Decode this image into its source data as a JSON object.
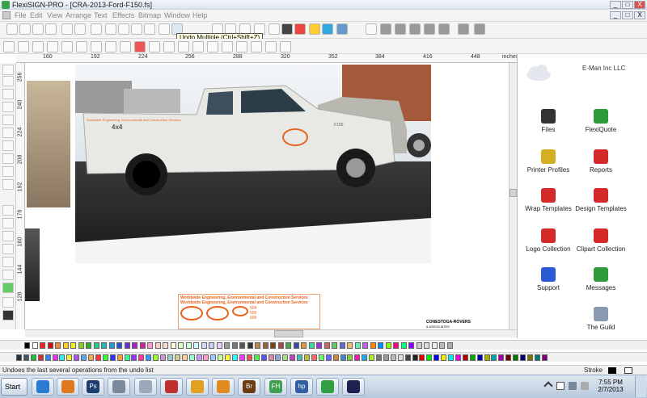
{
  "window": {
    "title": "FlexiSIGN-PRO - [CRA-2013-Ford-F150.fs]",
    "controls": [
      "_",
      "□",
      "X"
    ],
    "doc_controls": [
      "_",
      "□",
      "X"
    ]
  },
  "menu": [
    "File",
    "Edit",
    "View",
    "Arrange",
    "Text",
    "Effects",
    "Bitmap",
    "Window",
    "Help"
  ],
  "tooltip": "Undo Multiple (Ctrl+Shift+Z)",
  "ruler": {
    "unit": "inches",
    "h_labels": [
      "160",
      "192",
      "224",
      "256",
      "288",
      "320",
      "352",
      "384",
      "416",
      "448"
    ],
    "v_labels": [
      "256",
      "240",
      "224",
      "208",
      "192",
      "176",
      "160",
      "144",
      "128"
    ]
  },
  "canvas": {
    "truck_badge": "4x4",
    "truck_slogan": "Worldwide Engineering, Environmental and Construction Services",
    "truck_model": "F150",
    "decal_line1": "Worldwide Engineering, Environmental and Construction Services",
    "decal_line2": "Worldwide Engineering, Environmental and Construction Services",
    "decal_numbers": [
      "504",
      "505",
      "506"
    ],
    "company_logo_line1": "CONESTOGA-ROVERS",
    "company_logo_line2": "& ASSOCIATES"
  },
  "panel": {
    "company": "E-Man Inc LLC",
    "items": [
      {
        "label": "Files",
        "icon": "files-icon",
        "color": "#333333"
      },
      {
        "label": "FlexiQuote",
        "icon": "flexiquote-icon",
        "color": "#2e9b3a"
      },
      {
        "label": "Printer Profiles",
        "icon": "printer-profiles-icon",
        "color": "#d4b020"
      },
      {
        "label": "Reports",
        "icon": "reports-icon",
        "color": "#d42a2a"
      },
      {
        "label": "Wrap Templates",
        "icon": "wrap-templates-icon",
        "color": "#d42a2a"
      },
      {
        "label": "Design Templates",
        "icon": "design-templates-icon",
        "color": "#d42a2a"
      },
      {
        "label": "Logo Collection",
        "icon": "logo-collection-icon",
        "color": "#d42a2a"
      },
      {
        "label": "Clipart Collection",
        "icon": "clipart-collection-icon",
        "color": "#d42a2a"
      },
      {
        "label": "Support",
        "icon": "support-icon",
        "color": "#2a5bd4"
      },
      {
        "label": "Messages",
        "icon": "messages-icon",
        "color": "#2e9b3a"
      },
      {
        "label": "The Guild",
        "icon": "the-guild-icon",
        "color": "#8a9ab0"
      }
    ]
  },
  "status": {
    "message": "Undoes the last several operations from the undo list",
    "stroke_label": "Stroke"
  },
  "taskbar": {
    "start": "Start",
    "apps": [
      {
        "icon": "internet-explorer-icon",
        "color": "#2a7bd4"
      },
      {
        "icon": "media-player-icon",
        "color": "#e07820"
      },
      {
        "icon": "photoshop-icon",
        "color": "#1c3d6e",
        "text": "Ps"
      },
      {
        "icon": "flexi-tool-icon",
        "color": "#7a8a9a"
      },
      {
        "icon": "calculator-icon",
        "color": "#9aa8b8"
      },
      {
        "icon": "scissors-app-icon",
        "color": "#c03030"
      },
      {
        "icon": "chrome-icon",
        "color": "#e0a020"
      },
      {
        "icon": "flexi-production-icon",
        "color": "#e08a20"
      },
      {
        "icon": "bridge-icon",
        "color": "#6a3a10",
        "text": "Br"
      },
      {
        "icon": "flexi-fh-icon",
        "color": "#40a050",
        "text": "FH"
      },
      {
        "icon": "hp-icon",
        "color": "#3060a0",
        "text": "hp"
      },
      {
        "icon": "settings-gears-icon",
        "color": "#30a040"
      },
      {
        "icon": "star-app-icon",
        "color": "#202050"
      }
    ],
    "time": "7:55 PM",
    "date": "2/7/2013"
  },
  "colors": {
    "accent_orange": "#e8641e",
    "panel_bg": "#ffffff",
    "toolbar_bg": "#f4f4f4"
  }
}
